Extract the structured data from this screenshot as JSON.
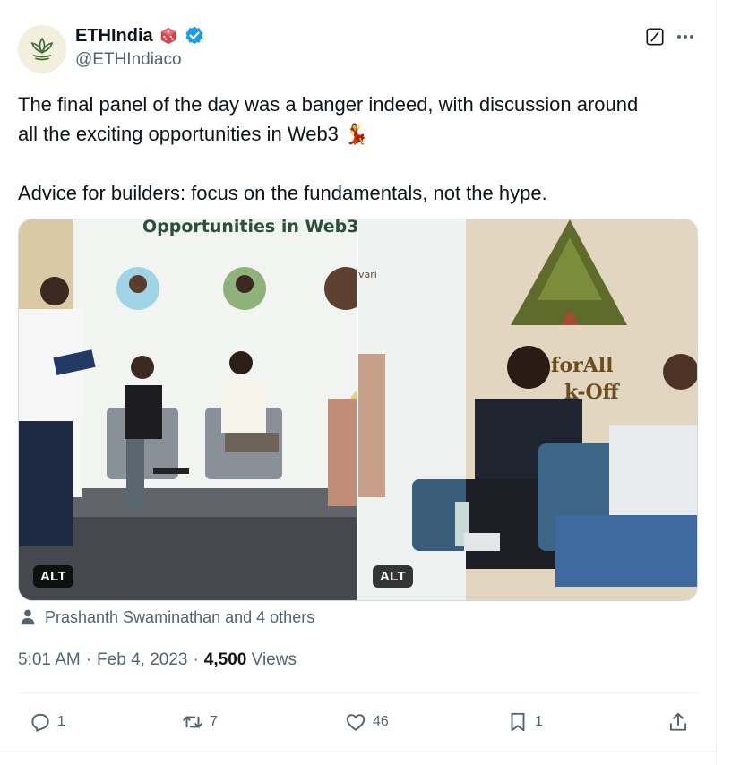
{
  "author": {
    "display_name": "ETHIndia",
    "handle": "@ETHIndiaco",
    "avatar_icon": "lotus-logo-icon",
    "badges": [
      "dice-emoji-icon",
      "verified-badge-icon"
    ],
    "accent_color": "#1d9bf0"
  },
  "header_actions": {
    "grok_icon": "grok-icon",
    "more_icon": "more-dots-icon"
  },
  "tweet": {
    "text": "The final panel of the day was a banger indeed, with discussion around\nall the exciting opportunities in Web3 💃\n\nAdvice for builders: focus on the fundamentals, not the hype."
  },
  "media": [
    {
      "alt_label": "ALT",
      "description_icon": "panel-discussion-photo"
    },
    {
      "alt_label": "ALT",
      "description_icon": "panel-discussion-photo"
    }
  ],
  "liked_by": "Prashanth Swaminathan and 4 others",
  "meta": {
    "time": "5:01 AM",
    "date": "Feb 4, 2023",
    "views_count": "4,500",
    "views_label": "Views"
  },
  "actions": {
    "reply_count": "1",
    "retweet_count": "7",
    "like_count": "46",
    "bookmark_count": "1"
  },
  "colors": {
    "text_primary": "#0f1419",
    "text_secondary": "#536471",
    "border": "#eff3f4"
  }
}
